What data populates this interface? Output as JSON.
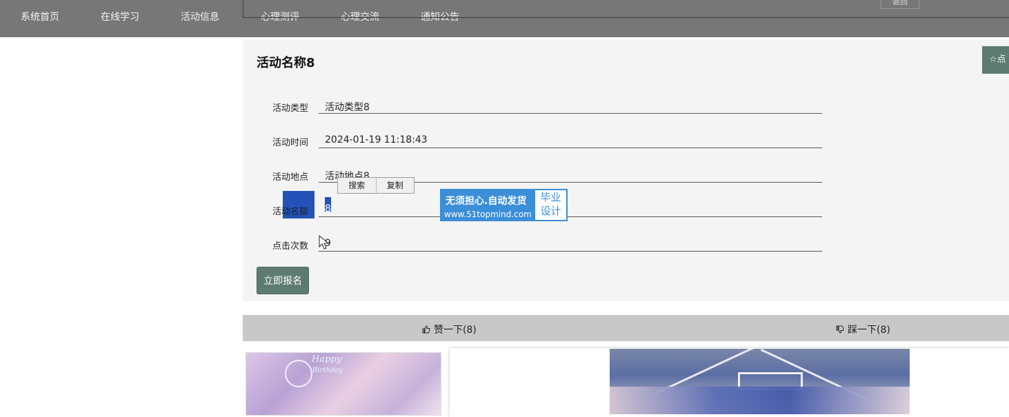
{
  "nav": {
    "items": [
      "系统首页",
      "在线学习",
      "活动信息",
      "心理测评",
      "心理交流",
      "通知公告"
    ],
    "back_label": "返回"
  },
  "detail": {
    "title": "活动名称8",
    "fav_label": "☆点",
    "fields": [
      {
        "label": "活动类型",
        "value": "活动类型8"
      },
      {
        "label": "活动时间",
        "value": "2024-01-19 11:18:43"
      },
      {
        "label": "活动地点",
        "value": "活动地点8"
      },
      {
        "label": "活动名额",
        "value": "8"
      },
      {
        "label": "点击次数",
        "value": "9"
      }
    ],
    "signup_label": "立即报名"
  },
  "context_menu": {
    "items": [
      "搜索",
      "复制"
    ]
  },
  "watermark": {
    "line1": "无须担心.自动发货",
    "line2": "www.51topmind.com",
    "badge_top": "毕业",
    "badge_bottom": "设计"
  },
  "vote": {
    "like_label": "赞一下(8)",
    "dislike_label": "踩一下(8)"
  },
  "images": {
    "photo1_text_line1": "Happy",
    "photo1_text_line2": "Birthday"
  },
  "colors": {
    "nav_bg": "#777777",
    "accent": "#5e7b72",
    "selection": "#2353b8",
    "watermark": "#3b8ed8"
  }
}
